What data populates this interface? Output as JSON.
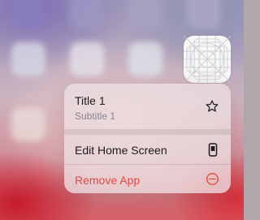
{
  "screen": {
    "background_colors": {
      "top": "#9d98ba",
      "bottom": "#d46067"
    }
  },
  "app": {
    "icon_name": "app-placeholder-grid-icon",
    "icon_background": "#f7f7f8"
  },
  "context_menu": {
    "title": "Title 1",
    "subtitle": "Subtitle 1",
    "title_icon": "star-icon",
    "items": [
      {
        "label": "Edit Home Screen",
        "icon": "phone-icon",
        "color": "#1c1c1e"
      },
      {
        "label": "Remove App",
        "icon": "minus-circle-icon",
        "color": "#e8483d"
      }
    ]
  }
}
